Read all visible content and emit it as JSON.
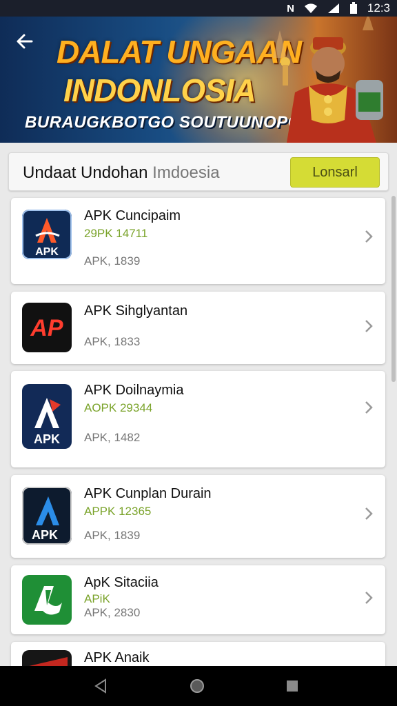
{
  "status_bar": {
    "icons": [
      "nfc-icon",
      "wifi-icon",
      "signal-icon",
      "battery-icon"
    ],
    "nfc_label": "N",
    "time": "12:3"
  },
  "banner": {
    "line1": "DALAT UNGAAN",
    "line2": "INDONLOSIA",
    "line3": "BURAUGKBOTGO SOUTUUNOPONINOS"
  },
  "header": {
    "title_main": "Undaat Undohan",
    "title_muted": "Imdoesia",
    "button_label": "Lonsarl"
  },
  "apps": [
    {
      "name": "APK Cuncipaim",
      "version": "29PK 14711",
      "size": "APK, 1839",
      "icon_label": "APK"
    },
    {
      "name": "APK Sihglyantan",
      "version": "",
      "size": "APK, 1833",
      "icon_label": "AP"
    },
    {
      "name": "APK Doilnaymia",
      "version": "AOPK 29344",
      "size": "APK, 1482",
      "icon_label": "APK"
    },
    {
      "name": "APK Cunplan Durain",
      "version": "APPK 12365",
      "size": "APK, 1839",
      "icon_label": "APK"
    },
    {
      "name": "ApK Sitaciia",
      "version": "APiK",
      "size": "APK, 2830",
      "icon_label": ""
    },
    {
      "name": "APK Anaik",
      "version": "",
      "size": "",
      "icon_label": ""
    }
  ],
  "colors": {
    "accent_button": "#d5dc35",
    "version_green": "#7aa32a",
    "banner_orange": "#ffb020"
  }
}
